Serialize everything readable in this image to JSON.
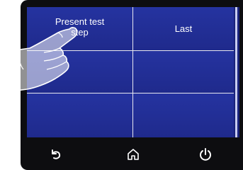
{
  "grid": {
    "cells": [
      [
        "Present test\nstep",
        "Last"
      ],
      [
        "",
        ""
      ],
      [
        "",
        ""
      ]
    ]
  },
  "bottom_bar": {
    "icons": [
      "back-icon",
      "home-icon",
      "power-icon"
    ]
  },
  "colors": {
    "screen_bg": "#1f2a8c",
    "grid_line": "#e8e8f0",
    "device_bezel": "#0d0d10",
    "text": "#ffffff"
  }
}
